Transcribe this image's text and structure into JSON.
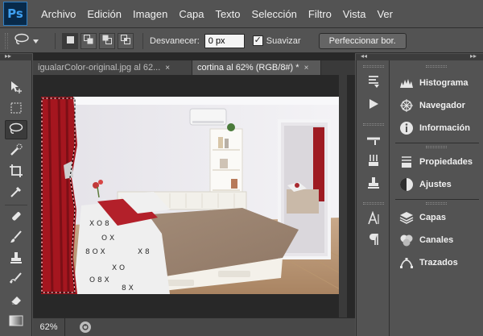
{
  "app": {
    "logo": "Ps"
  },
  "menu": [
    "Archivo",
    "Edición",
    "Imagen",
    "Capa",
    "Texto",
    "Selección",
    "Filtro",
    "Vista",
    "Ver"
  ],
  "options": {
    "feather_label": "Desvanecer:",
    "feather_value": "0 px",
    "smooth_label": "Suavizar",
    "smooth_checked": "✓",
    "refine_label": "Perfeccionar bor."
  },
  "tabs": [
    {
      "label": "igualarColor-original.jpg al 62...",
      "close": "×"
    },
    {
      "label": "cortina al 62% (RGB/8#) *",
      "close": "×"
    }
  ],
  "status": {
    "zoom": "62%"
  },
  "panels": [
    {
      "label": "Histograma",
      "icon": "histogram-icon"
    },
    {
      "label": "Navegador",
      "icon": "navigator-icon"
    },
    {
      "label": "Información",
      "icon": "info-icon"
    },
    {
      "label": "Propiedades",
      "icon": "properties-icon"
    },
    {
      "label": "Ajustes",
      "icon": "adjustments-icon"
    },
    {
      "label": "Capas",
      "icon": "layers-icon"
    },
    {
      "label": "Canales",
      "icon": "channels-icon"
    },
    {
      "label": "Trazados",
      "icon": "paths-icon"
    }
  ],
  "colors": {
    "accent": "#3fa0f0",
    "panel_bg": "#535353",
    "workspace": "#282828"
  }
}
